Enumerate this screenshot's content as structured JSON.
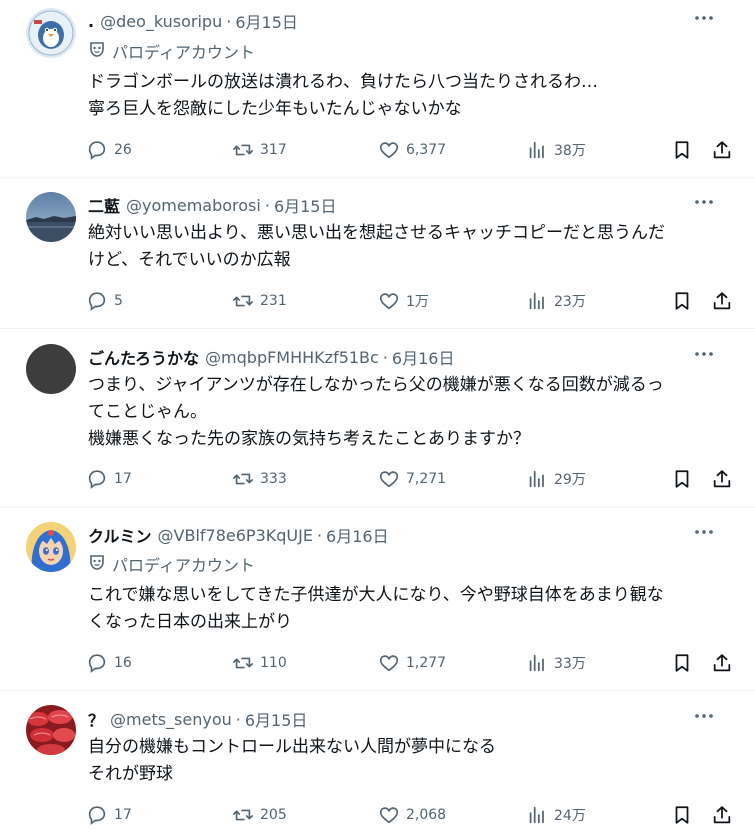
{
  "posts": [
    {
      "name": ".",
      "handle": "@deo_kusoripu",
      "sep": "·",
      "date": "6月15日",
      "parody": "パロディアカウント",
      "lines": [
        "ドラゴンボールの放送は潰れるわ、負けたら八つ当たりされるわ…",
        "寧ろ巨人を怨敵にした少年もいたんじゃないかな"
      ],
      "replies": "26",
      "retweets": "317",
      "likes": "6,377",
      "views": "38万",
      "avatar": "avatar-penguin"
    },
    {
      "name": "二藍",
      "handle": "@yomemaborosi",
      "sep": "·",
      "date": "6月15日",
      "lines": [
        "絶対いい思い出より、悪い思い出を想起させるキャッチコピーだと思うんだ",
        "けど、それでいいのか広報"
      ],
      "replies": "5",
      "retweets": "231",
      "likes": "1万",
      "views": "23万",
      "avatar": "avatar-landscape"
    },
    {
      "name": "ごんたろうかな",
      "handle": "@mqbpFMHHKzf51Bc",
      "sep": "·",
      "date": "6月16日",
      "lines": [
        "つまり、ジャイアンツが存在しなかったら父の機嫌が悪くなる回数が減るっ",
        "てことじゃん。",
        "機嫌悪くなった先の家族の気持ち考えたことありますか？"
      ],
      "replies": "17",
      "retweets": "333",
      "likes": "7,271",
      "views": "29万",
      "avatar": "avatar-default"
    },
    {
      "name": "クルミン",
      "handle": "@VBlf78e6P3KqUJE",
      "sep": "·",
      "date": "6月16日",
      "parody": "パロディアカウント",
      "lines": [
        "これで嫌な思いをしてきた子供達が大人になり、今や野球自体をあまり観な",
        "くなった日本の出来上がり"
      ],
      "replies": "16",
      "retweets": "110",
      "likes": "1,277",
      "views": "33万",
      "avatar": "avatar-anime"
    },
    {
      "name": "？",
      "handle": "@mets_senyou",
      "sep": "·",
      "date": "6月15日",
      "lines": [
        "自分の機嫌もコントロール出来ない人間が夢中になる",
        "それが野球"
      ],
      "replies": "17",
      "retweets": "205",
      "likes": "2,068",
      "views": "24万",
      "avatar": "avatar-food"
    }
  ],
  "colors": {
    "text": "#0f1419",
    "muted": "#536471",
    "border": "#eff3f4"
  }
}
